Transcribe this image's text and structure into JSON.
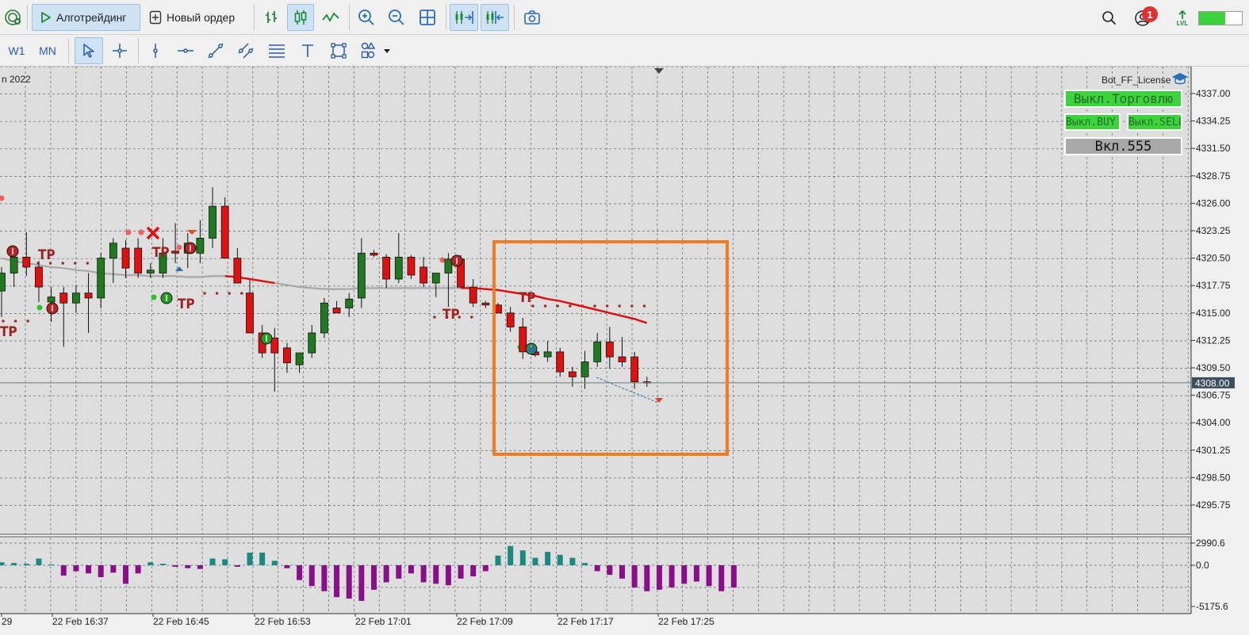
{
  "toolbar": {
    "algotrading_label": "Алготрейдинг",
    "new_order_label": "Новый ордер",
    "notification_count": "1",
    "lvl_label": "LVL"
  },
  "timeframes": [
    "W1",
    "MN"
  ],
  "chart": {
    "period_label": "n 2022",
    "expert_name": "Bot_FF_License",
    "current_price": "4308.00",
    "price_ticks": [
      "4337.00",
      "4334.25",
      "4331.50",
      "4328.75",
      "4326.00",
      "4323.25",
      "4320.50",
      "4317.75",
      "4315.00",
      "4312.25",
      "4309.50",
      "4306.75",
      "4304.00",
      "4301.25",
      "4298.50",
      "4295.75"
    ],
    "indicator_ticks": [
      "2990.6",
      "0.0",
      "-5175.6"
    ],
    "time_ticks": [
      "29",
      "22 Feb 16:37",
      "22 Feb 16:45",
      "22 Feb 16:53",
      "22 Feb 17:01",
      "22 Feb 17:09",
      "22 Feb 17:17",
      "22 Feb 17:25"
    ],
    "tp_label": "TP",
    "colors": {
      "bull": "#1f7a1f",
      "bear": "#e01010",
      "ma": "#a8a8a8",
      "ma_down": "#e01010",
      "hist_pos": "#1a8a80",
      "hist_neg": "#8a0d8a",
      "highlight": "#f47c20",
      "grid": "#5a6a6a"
    }
  },
  "panel": {
    "trading_button": "Выкл.Торговлю",
    "buy_button": "Выкл.BUY",
    "sell_button": "Выкл.SELL",
    "magic_button": "Вкл.555"
  },
  "chart_data": {
    "type": "candlestick",
    "candles": [
      {
        "o": 4317.2,
        "h": 4319.6,
        "l": 4314.6,
        "c": 4319.0
      },
      {
        "o": 4319.0,
        "h": 4321.6,
        "l": 4317.6,
        "c": 4320.6
      },
      {
        "o": 4320.6,
        "h": 4323.1,
        "l": 4318.7,
        "c": 4319.6
      },
      {
        "o": 4319.6,
        "h": 4320.2,
        "l": 4316.1,
        "c": 4317.6
      },
      {
        "o": 4316.1,
        "h": 4317.6,
        "l": 4314.1,
        "c": 4316.6
      },
      {
        "o": 4317.0,
        "h": 4317.6,
        "l": 4311.6,
        "c": 4316.0
      },
      {
        "o": 4316.0,
        "h": 4317.8,
        "l": 4315.0,
        "c": 4317.0
      },
      {
        "o": 4317.0,
        "h": 4319.0,
        "l": 4313.0,
        "c": 4316.5
      },
      {
        "o": 4316.5,
        "h": 4321.0,
        "l": 4315.5,
        "c": 4320.5
      },
      {
        "o": 4320.5,
        "h": 4322.5,
        "l": 4318.0,
        "c": 4322.0
      },
      {
        "o": 4321.5,
        "h": 4322.3,
        "l": 4318.5,
        "c": 4319.5
      },
      {
        "o": 4321.5,
        "h": 4322.5,
        "l": 4318.5,
        "c": 4319.0
      },
      {
        "o": 4319.0,
        "h": 4320.0,
        "l": 4318.5,
        "c": 4319.3
      },
      {
        "o": 4319.0,
        "h": 4322.5,
        "l": 4318.5,
        "c": 4321.0
      },
      {
        "o": 4321.2,
        "h": 4324.0,
        "l": 4320.0,
        "c": 4321.0
      },
      {
        "o": 4321.0,
        "h": 4323.0,
        "l": 4319.5,
        "c": 4322.0
      },
      {
        "o": 4321.0,
        "h": 4324.3,
        "l": 4320.0,
        "c": 4322.5
      },
      {
        "o": 4322.5,
        "h": 4327.6,
        "l": 4321.5,
        "c": 4325.7
      },
      {
        "o": 4325.7,
        "h": 4326.6,
        "l": 4321.5,
        "c": 4320.5
      },
      {
        "o": 4320.5,
        "h": 4321.5,
        "l": 4318.5,
        "c": 4318.0
      },
      {
        "o": 4317.0,
        "h": 4318.3,
        "l": 4313.5,
        "c": 4313.0
      },
      {
        "o": 4313.0,
        "h": 4313.8,
        "l": 4310.5,
        "c": 4311.0
      },
      {
        "o": 4312.5,
        "h": 4313.5,
        "l": 4307.1,
        "c": 4311.0
      },
      {
        "o": 4311.5,
        "h": 4312.0,
        "l": 4309.0,
        "c": 4310.0
      },
      {
        "o": 4309.8,
        "h": 4311.0,
        "l": 4309.0,
        "c": 4311.0
      },
      {
        "o": 4311.0,
        "h": 4313.8,
        "l": 4310.5,
        "c": 4313.0
      },
      {
        "o": 4313.0,
        "h": 4316.5,
        "l": 4312.5,
        "c": 4316.0
      },
      {
        "o": 4315.5,
        "h": 4316.2,
        "l": 4315.0,
        "c": 4315.0
      },
      {
        "o": 4315.5,
        "h": 4317.0,
        "l": 4314.6,
        "c": 4316.4
      },
      {
        "o": 4316.5,
        "h": 4322.5,
        "l": 4315.5,
        "c": 4321.0
      },
      {
        "o": 4321.0,
        "h": 4321.3,
        "l": 4320.6,
        "c": 4320.8
      },
      {
        "o": 4320.6,
        "h": 4320.9,
        "l": 4317.5,
        "c": 4318.4
      },
      {
        "o": 4318.4,
        "h": 4323.0,
        "l": 4318.0,
        "c": 4320.6
      },
      {
        "o": 4320.6,
        "h": 4320.8,
        "l": 4318.4,
        "c": 4318.8
      },
      {
        "o": 4319.6,
        "h": 4320.6,
        "l": 4317.6,
        "c": 4318.0
      },
      {
        "o": 4318.0,
        "h": 4319.0,
        "l": 4316.6,
        "c": 4319.0
      },
      {
        "o": 4319.0,
        "h": 4321.0,
        "l": 4315.6,
        "c": 4320.4
      },
      {
        "o": 4320.4,
        "h": 4320.8,
        "l": 4318.1,
        "c": 4317.6
      },
      {
        "o": 4317.6,
        "h": 4318.4,
        "l": 4315.6,
        "c": 4316.0
      },
      {
        "o": 4316.0,
        "h": 4316.2,
        "l": 4315.5,
        "c": 4315.8
      },
      {
        "o": 4315.8,
        "h": 4316.0,
        "l": 4315.0,
        "c": 4315.0
      },
      {
        "o": 4315.0,
        "h": 4315.6,
        "l": 4313.1,
        "c": 4313.6
      },
      {
        "o": 4313.6,
        "h": 4314.5,
        "l": 4310.4,
        "c": 4311.1
      },
      {
        "o": 4311.1,
        "h": 4311.5,
        "l": 4310.6,
        "c": 4310.8
      },
      {
        "o": 4310.6,
        "h": 4312.2,
        "l": 4310.1,
        "c": 4311.1
      },
      {
        "o": 4311.1,
        "h": 4311.5,
        "l": 4308.6,
        "c": 4309.1
      },
      {
        "o": 4309.1,
        "h": 4309.6,
        "l": 4307.6,
        "c": 4308.6
      },
      {
        "o": 4308.6,
        "h": 4311.2,
        "l": 4307.4,
        "c": 4310.1
      },
      {
        "o": 4310.1,
        "h": 4313.0,
        "l": 4309.6,
        "c": 4312.1
      },
      {
        "o": 4312.1,
        "h": 4313.6,
        "l": 4309.4,
        "c": 4310.6
      },
      {
        "o": 4310.6,
        "h": 4312.6,
        "l": 4309.6,
        "c": 4310.1
      },
      {
        "o": 4310.6,
        "h": 4311.1,
        "l": 4307.4,
        "c": 4308.1
      },
      {
        "o": 4308.1,
        "h": 4308.6,
        "l": 4307.6,
        "c": 4308.0
      }
    ],
    "ma": [
      4320.5,
      4320.2,
      4320.0,
      4319.8,
      4319.6,
      4319.5,
      4319.3,
      4319.2,
      4319.0,
      4318.9,
      4318.8,
      4318.8,
      4318.7,
      4318.7,
      4318.7,
      4318.6,
      4318.6,
      4318.7,
      4318.7,
      4318.6,
      4318.4,
      4318.2,
      4318.0,
      4317.8,
      4317.6,
      4317.5,
      4317.4,
      4317.4,
      4317.4,
      4317.5,
      4317.5,
      4317.5,
      4317.5,
      4317.5,
      4317.5,
      4317.5,
      4317.5,
      4317.5,
      4317.5,
      4317.4,
      4317.3,
      4317.1,
      4316.9,
      4316.7,
      4316.4,
      4316.2,
      4315.9,
      4315.6,
      4315.3,
      4315.0,
      4314.7,
      4314.4,
      4314.0
    ],
    "ma_red_from": [
      18,
      37
    ],
    "histogram": [
      400,
      300,
      200,
      900,
      100,
      -1400,
      -800,
      -1100,
      -1600,
      -1000,
      -2500,
      -1100,
      400,
      200,
      -200,
      -400,
      -500,
      900,
      800,
      -200,
      1700,
      1700,
      600,
      -400,
      -2000,
      -2800,
      -3500,
      -4300,
      -4500,
      -4800,
      -3300,
      -2300,
      -1800,
      -1100,
      -2300,
      -2500,
      -2700,
      -1800,
      -1500,
      -800,
      1300,
      2600,
      2000,
      1000,
      1800,
      1400,
      1000,
      300,
      -800,
      -1300,
      -1800,
      -3000,
      -3500,
      -3300,
      -3000,
      -2500,
      -2200,
      -2800,
      -3500,
      -3000
    ],
    "ranges": {
      "price": [
        4294.0,
        4338.7
      ],
      "indicator": [
        -5175.6,
        2990.6
      ]
    }
  }
}
